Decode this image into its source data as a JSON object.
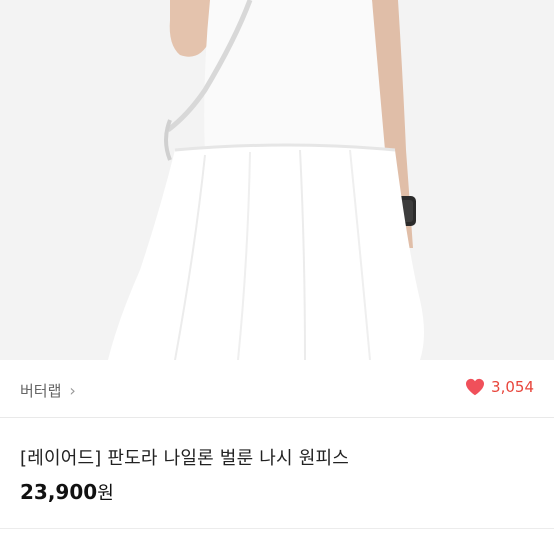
{
  "product": {
    "brand": "버터랩",
    "likes": "3,054",
    "title": "[레이어드] 판도라 나일론 벌룬 나시 원피스",
    "price": "23,900",
    "currency": "원"
  },
  "icons": {
    "brand_chevron": "chevron-right-icon",
    "like": "heart-icon"
  },
  "colors": {
    "heart": "#f0505a",
    "like_text": "#e8463c"
  }
}
